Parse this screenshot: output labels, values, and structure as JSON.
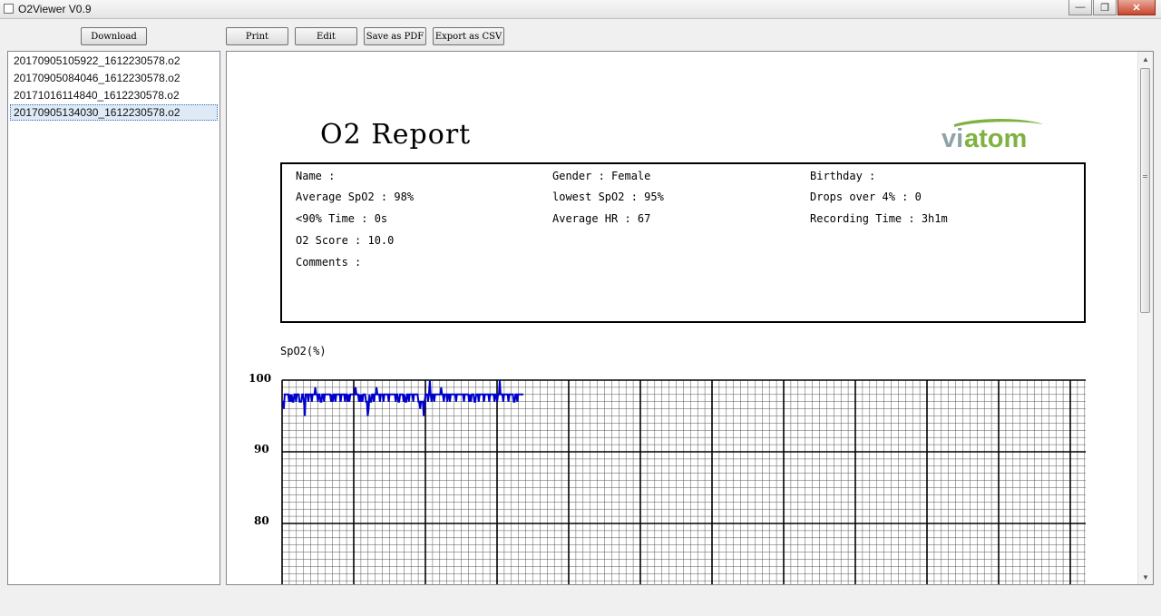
{
  "window": {
    "title": "O2Viewer V0.9"
  },
  "toolbar": {
    "download_label": "Download",
    "print_label": "Print",
    "edit_label": "Edit",
    "save_pdf_label": "Save as PDF",
    "export_csv_label": "Export as CSV"
  },
  "files": [
    "20170905105922_1612230578.o2",
    "20170905084046_1612230578.o2",
    "20171016114840_1612230578.o2",
    "20170905134030_1612230578.o2"
  ],
  "selected_file_index": 3,
  "report": {
    "title": "O2 Report",
    "logo_text": "viatom",
    "name": "Name :",
    "gender": "Gender : Female",
    "birthday": "Birthday :",
    "avg_spo2": "Average SpO2 : 98%",
    "lowest_spo2": "lowest SpO2 : 95%",
    "drops": "Drops over 4% : 0",
    "below90": "<90% Time : 0s",
    "avg_hr": "Average HR : 67",
    "recording": "Recording Time : 3h1m",
    "score": "O2 Score : 10.0",
    "comments": "Comments :"
  },
  "chart_data": {
    "type": "line",
    "ylabel": "SpO2(%)",
    "y_ticks": [
      "100",
      "90",
      "80"
    ],
    "ylim": [
      77,
      100
    ],
    "color": "#0000cc",
    "grid": true,
    "values": [
      97,
      97,
      96,
      98,
      98,
      98,
      98,
      98,
      97,
      98,
      97,
      98,
      97,
      97,
      98,
      98,
      97,
      98,
      98,
      98,
      97,
      97,
      97,
      98,
      98,
      97,
      95,
      98,
      98,
      98,
      97,
      98,
      98,
      98,
      97,
      98,
      98,
      98,
      99,
      98,
      98,
      97,
      98,
      98,
      97,
      97,
      98,
      98,
      97,
      98,
      98,
      98,
      98,
      98,
      98,
      98,
      97,
      98,
      97,
      98,
      98,
      97,
      98,
      98,
      98,
      98,
      98,
      97,
      98,
      98,
      98,
      98,
      97,
      98,
      98,
      97,
      98,
      97,
      98,
      98,
      98,
      98,
      98,
      98,
      99,
      98,
      98,
      98,
      97,
      98,
      97,
      98,
      97,
      98,
      98,
      98,
      97,
      97,
      95,
      96,
      98,
      97,
      97,
      98,
      98,
      97,
      98,
      98,
      99,
      98,
      98,
      98,
      97,
      98,
      98,
      98,
      97,
      98,
      98,
      98,
      98,
      98,
      97,
      98,
      98,
      98,
      98,
      98,
      98,
      98,
      97,
      98,
      98,
      97,
      97,
      98,
      98,
      98,
      98,
      97,
      98,
      97,
      97,
      98,
      98,
      97,
      98,
      98,
      98,
      98,
      97,
      98,
      98,
      98,
      98,
      98,
      97,
      97,
      96,
      97,
      97,
      97,
      95,
      97,
      98,
      98,
      98,
      97,
      98,
      100,
      98,
      97,
      98,
      98,
      97,
      98,
      98,
      98,
      98,
      98,
      98,
      98,
      99,
      98,
      98,
      97,
      98,
      98,
      98,
      97,
      98,
      98,
      97,
      98,
      98,
      98,
      98,
      98,
      98,
      97,
      98,
      98,
      98,
      98,
      98,
      98,
      98,
      98,
      97,
      98,
      98,
      98,
      98,
      98,
      97,
      98,
      97,
      98,
      98,
      98,
      97,
      97,
      98,
      98,
      98,
      97,
      98,
      98,
      98,
      98,
      98,
      97,
      98,
      98,
      98,
      98,
      98,
      97,
      98,
      98,
      98,
      98,
      98,
      97,
      98,
      98,
      97,
      98,
      98,
      100,
      98,
      98,
      98,
      97,
      98,
      98,
      98,
      98,
      98,
      97,
      98,
      98,
      98,
      98,
      98,
      97,
      97,
      98,
      98,
      97,
      98,
      98,
      98,
      98,
      98,
      98,
      98
    ]
  }
}
